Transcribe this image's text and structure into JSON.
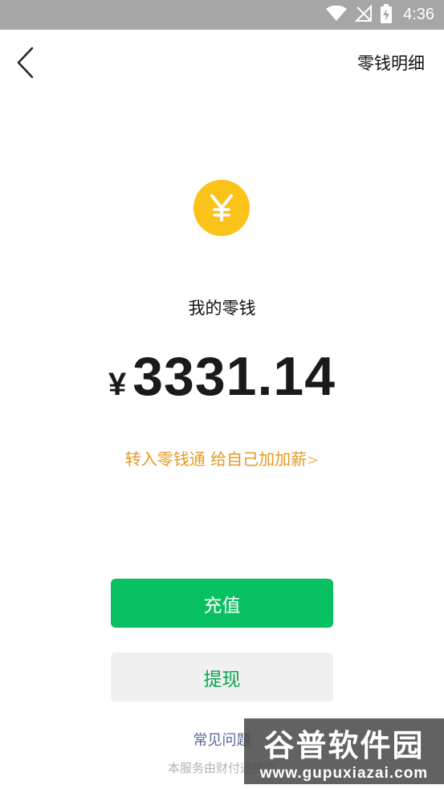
{
  "status_bar": {
    "time": "4:36",
    "icons": [
      "wifi-icon",
      "no-signal-icon",
      "battery-charging-icon"
    ]
  },
  "nav": {
    "back_icon": "chevron-left-icon",
    "right_action": "零钱明细"
  },
  "wallet": {
    "coin_icon": "yuan-coin-icon",
    "coin_symbol": "¥",
    "title": "我的零钱",
    "currency_symbol": "¥",
    "balance": "3331.14",
    "promo_text": "转入零钱通 给自己加加薪",
    "promo_arrow": ">"
  },
  "actions": {
    "recharge_label": "充值",
    "withdraw_label": "提现"
  },
  "footer": {
    "faq_text": "常见问题",
    "service_text": "本服务由财付通提供"
  },
  "watermark": {
    "title": "谷普软件园",
    "url": "www.gupuxiazai.com"
  },
  "colors": {
    "status_bar": "#a6a6a6",
    "coin": "#fbc21a",
    "primary_green": "#07c160",
    "promo_orange": "#e59a21",
    "link_blue": "#576b95"
  }
}
